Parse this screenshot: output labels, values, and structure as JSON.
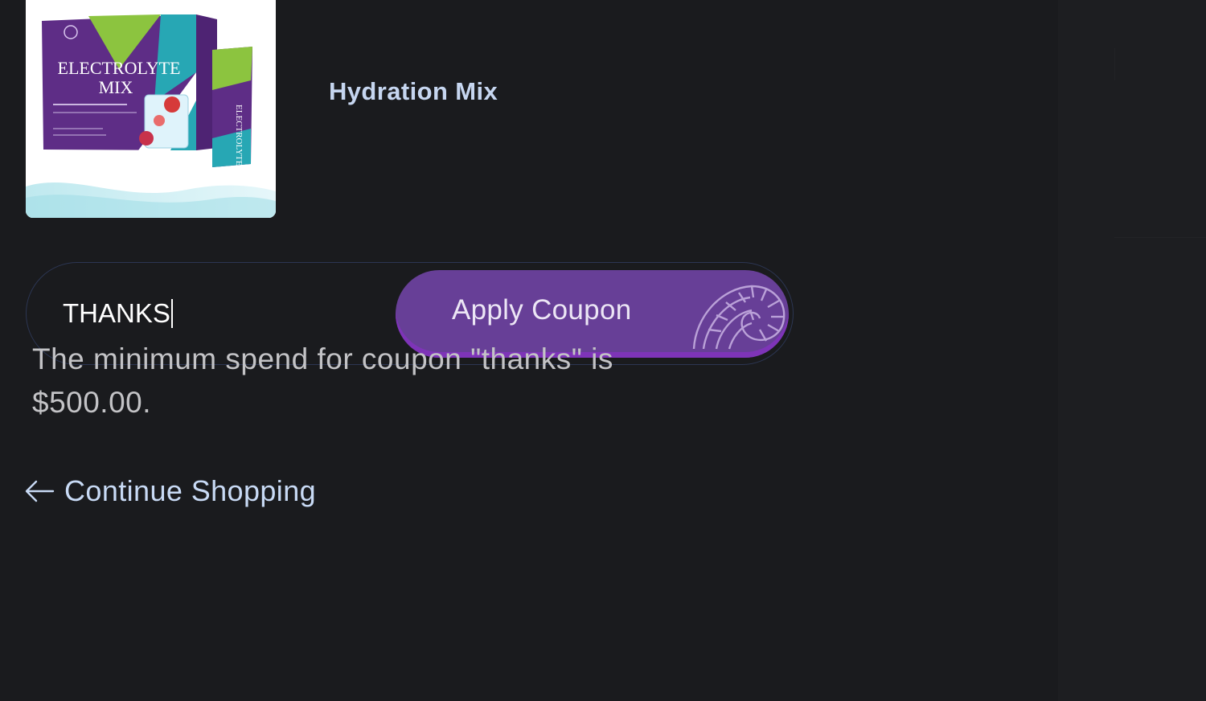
{
  "product": {
    "name": "Hydration Mix",
    "thumbnail": {
      "box_title": "ELECTROLYTE",
      "box_subtitle": "MIX",
      "sachet_label": "ELECTROLYTE MIX",
      "colors": {
        "box": "#5e2d86",
        "accent_green": "#8cc43f",
        "accent_teal": "#27a7b4"
      }
    }
  },
  "coupon": {
    "input_value": "THANKS",
    "apply_label": "Apply Coupon",
    "error_message": "The minimum spend for coupon \"thanks\" is $500.00."
  },
  "navigation": {
    "continue_label": "Continue Shopping",
    "continue_icon": "arrow-left-icon"
  },
  "colors": {
    "background": "#1a1b1e",
    "button": "#673f97",
    "link": "#c8daf5",
    "product_name": "#c6d6f0"
  }
}
